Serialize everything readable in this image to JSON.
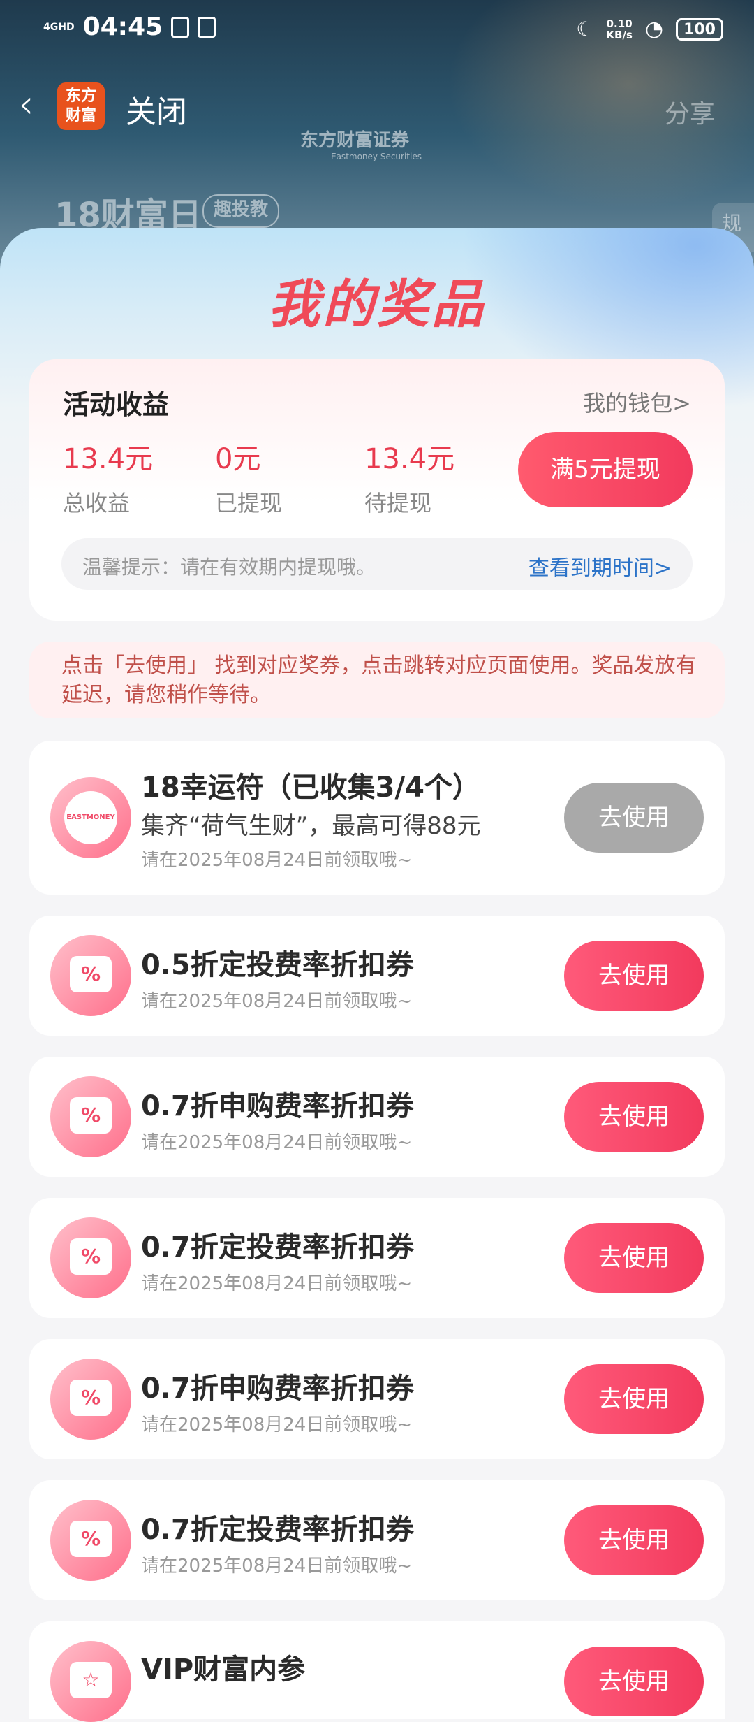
{
  "status_bar": {
    "network": "4GHD",
    "time": "04:45",
    "speed_value": "0.10",
    "speed_unit": "KB/s",
    "battery": "100"
  },
  "nav": {
    "logo_line1": "东方",
    "logo_line2": "财富",
    "close_label": "关闭",
    "share_label": "分享"
  },
  "background_page": {
    "brand_name": "东方财富证券",
    "brand_en": "Eastmoney Securities",
    "title": "18财富日",
    "tag": "趣投教",
    "side_label": "规"
  },
  "sheet": {
    "title": "我的奖品"
  },
  "earnings": {
    "title": "活动收益",
    "wallet_link": "我的钱包>",
    "total": {
      "value": "13.4",
      "unit": "元",
      "label": "总收益"
    },
    "withdrawn": {
      "value": "0",
      "unit": "元",
      "label": "已提现"
    },
    "pending": {
      "value": "13.4",
      "unit": "元",
      "label": "待提现"
    },
    "withdraw_button": "满5元提现",
    "tip_text": "温馨提示：请在有效期内提现哦。",
    "tip_link": "查看到期时间>"
  },
  "notice": "点击「去使用」 找到对应奖券，点击跳转对应页面使用。奖品发放有延迟，请您稍作等待。",
  "prizes": [
    {
      "name": "18幸运符（已收集3/4个）",
      "sub": "集齐“荷气生财”，最高可得88元",
      "date": "请在2025年08月24日前领取哦~",
      "button": "去使用",
      "icon_text": "EASTMONEY",
      "enabled": false
    },
    {
      "name": "0.5折定投费率折扣券",
      "date": "请在2025年08月24日前领取哦~",
      "button": "去使用",
      "icon_text": "%",
      "enabled": true
    },
    {
      "name": "0.7折申购费率折扣券",
      "date": "请在2025年08月24日前领取哦~",
      "button": "去使用",
      "icon_text": "%",
      "enabled": true
    },
    {
      "name": "0.7折定投费率折扣券",
      "date": "请在2025年08月24日前领取哦~",
      "button": "去使用",
      "icon_text": "%",
      "enabled": true
    },
    {
      "name": "0.7折申购费率折扣券",
      "date": "请在2025年08月24日前领取哦~",
      "button": "去使用",
      "icon_text": "%",
      "enabled": true
    },
    {
      "name": "0.7折定投费率折扣券",
      "date": "请在2025年08月24日前领取哦~",
      "button": "去使用",
      "icon_text": "%",
      "enabled": true
    },
    {
      "name": "VIP财富内参",
      "button": "去使用",
      "icon_text": "☆",
      "enabled": true
    }
  ],
  "colors": {
    "accent": "#f23a5d",
    "amount": "#e83a4e",
    "link": "#2c73c8",
    "disabled_button": "#a9a9a9"
  }
}
